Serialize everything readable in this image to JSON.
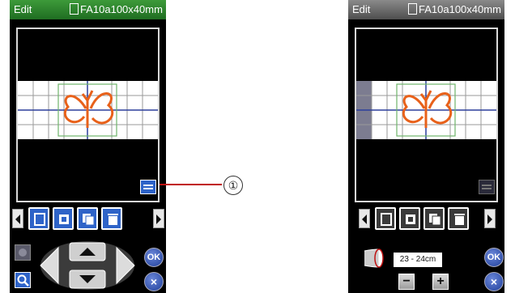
{
  "left_screen": {
    "title": "Edit",
    "hoop_label": "FA10a100x40mm",
    "ok_label": "OK",
    "cancel_label": "×"
  },
  "right_screen": {
    "title": "Edit",
    "hoop_label": "FA10a100x40mm",
    "ok_label": "OK",
    "cancel_label": "×",
    "width_value": "23 - 24cm",
    "minus_label": "−",
    "plus_label": "+"
  },
  "callout": {
    "number": "①"
  },
  "colors": {
    "title_green": "#2c8a2e",
    "title_gray": "#6b6b6b",
    "toolbar_blue": "#2e63c8",
    "design_orange": "#e8611a",
    "ok_blue": "#2747a8"
  },
  "icons": [
    "doc-icon",
    "layout-icon",
    "rotate-icon",
    "copy-icon",
    "delete-icon",
    "hand-icon",
    "zoom-icon",
    "arrow-up-icon",
    "arrow-down-icon",
    "arrow-left-icon",
    "arrow-right-icon",
    "cylinder-icon"
  ]
}
